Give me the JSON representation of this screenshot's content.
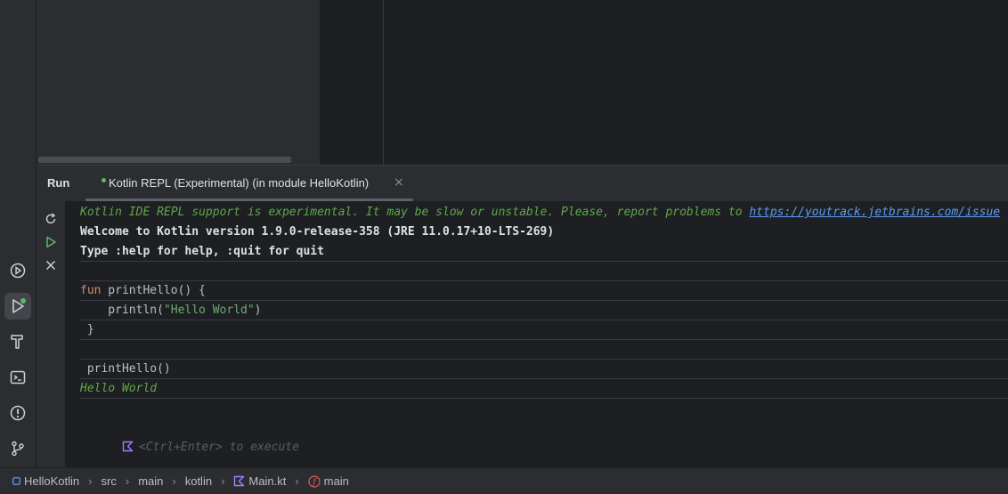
{
  "run_window": {
    "title": "Run",
    "tab": {
      "label": "Kotlin REPL (Experimental) (in module HelloKotlin)",
      "close_symbol": "×"
    }
  },
  "console": {
    "lines": [
      {
        "prefix": "Kotlin IDE REPL support is experimental. It may be slow or unstable. Please, report problems to ",
        "link": "https://youtrack.jetbrains.com/issue"
      },
      {
        "text": "Welcome to Kotlin version 1.9.0-release-358 (JRE 11.0.17+10-LTS-269)"
      },
      {
        "text": "Type :help for help, :quit for quit"
      },
      {
        "kw": "fun",
        "rest": " printHello() {"
      },
      {
        "pre": "    println(",
        "str": "\"Hello World\"",
        "post": ")"
      },
      {
        "text": " }"
      },
      {
        "text": " printHello()"
      },
      {
        "text": "Hello World"
      },
      {
        "hint": "<Ctrl+Enter> to execute"
      }
    ]
  },
  "breadcrumbs": {
    "items": [
      "HelloKotlin",
      "src",
      "main",
      "kotlin",
      "Main.kt",
      "main"
    ],
    "separator": "›"
  },
  "colors": {
    "accent_green": "#5fb865",
    "kotlin_purple": "#a97bff",
    "error_red": "#db5c5c",
    "link_blue": "#589df6"
  }
}
